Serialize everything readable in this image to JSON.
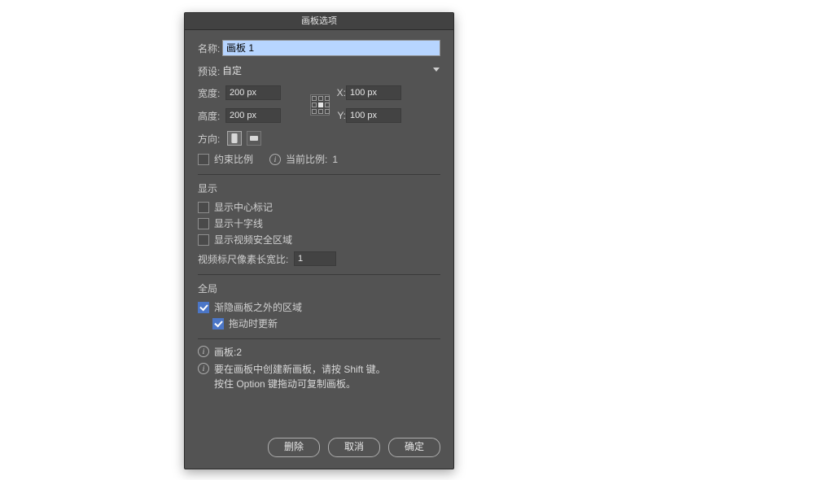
{
  "dialog": {
    "title": "画板选项",
    "name_label": "名称:",
    "name_value": "画板 1",
    "preset_label": "预设:",
    "preset_value": "自定",
    "width_label": "宽度:",
    "width_value": "200 px",
    "height_label": "高度:",
    "height_value": "200 px",
    "x_label": "X:",
    "x_value": "100 px",
    "y_label": "Y:",
    "y_value": "100 px",
    "orientation_label": "方向:",
    "constrain_label": "约束比例",
    "current_ratio_label": "当前比例:",
    "current_ratio_value": "1"
  },
  "view": {
    "section": "显示",
    "center_mark": "显示中心标记",
    "crosshairs": "显示十字线",
    "video_safe": "显示视频安全区域",
    "pixel_aspect_label": "视频标尺像素长宽比:",
    "pixel_aspect_value": "1"
  },
  "global": {
    "section": "全局",
    "fade_outside": "渐隐画板之外的区域",
    "update_on_drag": "拖动时更新"
  },
  "footer": {
    "artboards_label": "画板:",
    "artboards_count": "2",
    "tip_line1": "要在画板中创建新画板，请按 Shift 键。",
    "tip_line2": "按住 Option 键拖动可复制画板。"
  },
  "buttons": {
    "delete": "删除",
    "cancel": "取消",
    "ok": "确定"
  }
}
